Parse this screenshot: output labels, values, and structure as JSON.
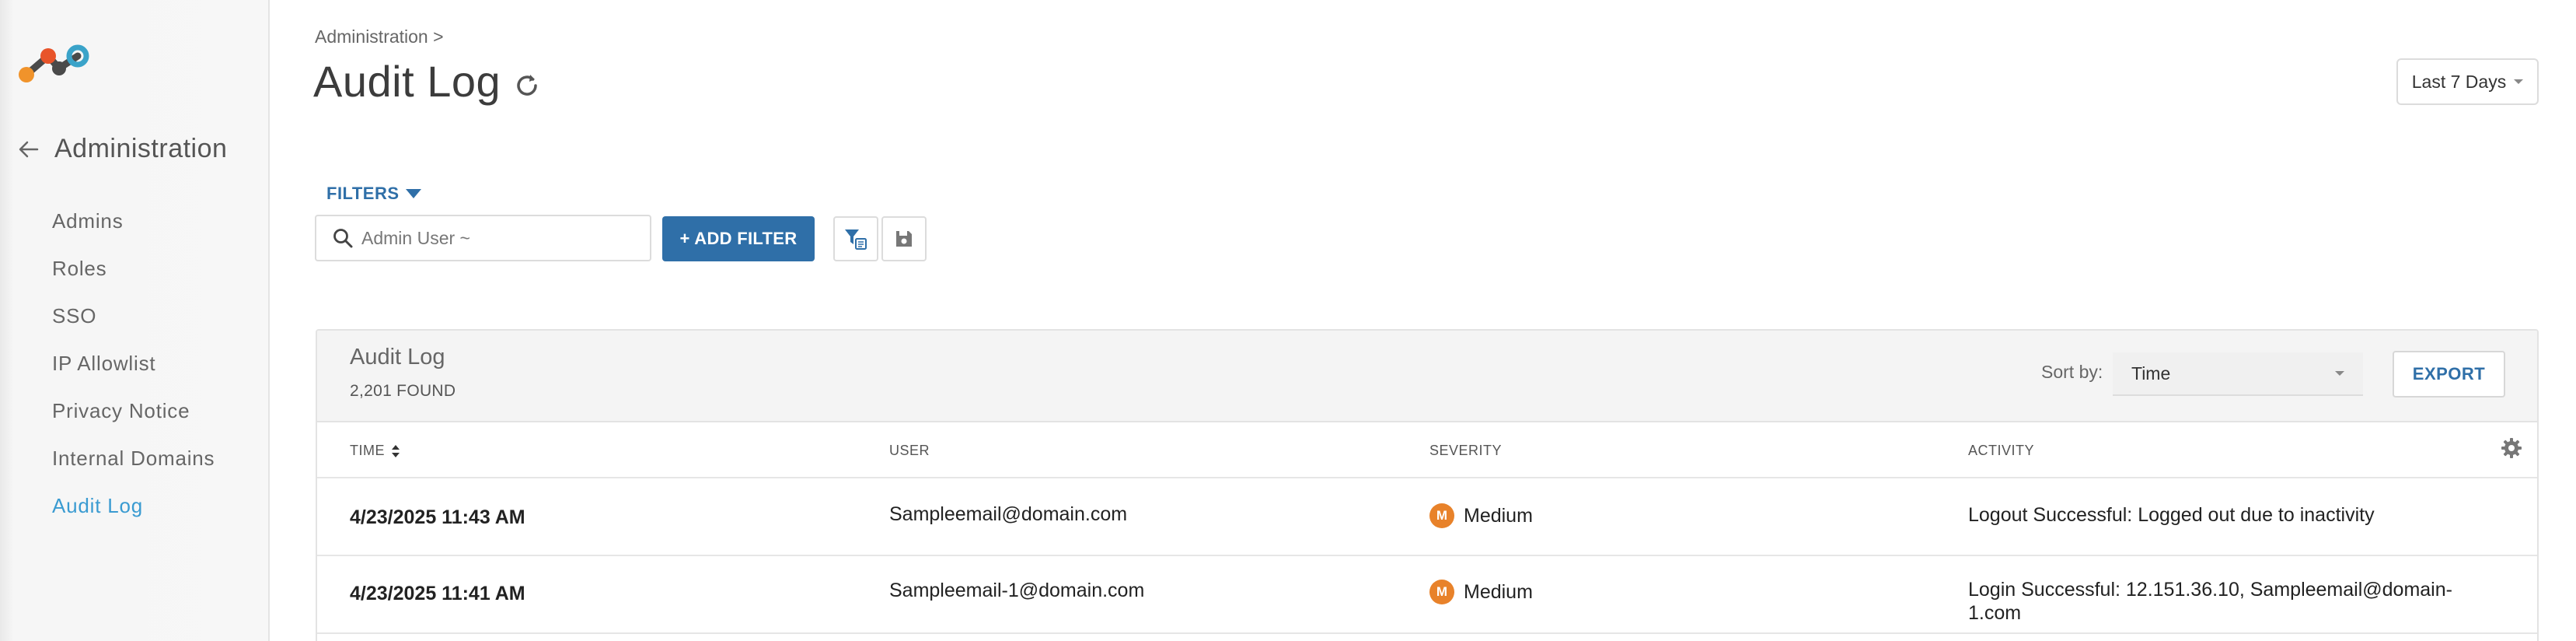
{
  "sidebar": {
    "section_title": "Administration",
    "items": [
      {
        "label": "Admins"
      },
      {
        "label": "Roles"
      },
      {
        "label": "SSO"
      },
      {
        "label": "IP Allowlist"
      },
      {
        "label": "Privacy Notice"
      },
      {
        "label": "Internal Domains"
      },
      {
        "label": "Audit Log",
        "active": true
      }
    ]
  },
  "header": {
    "breadcrumb": "Administration >",
    "title": "Audit Log",
    "date_range": "Last 7 Days"
  },
  "filters": {
    "toggle_label": "FILTERS",
    "search_placeholder": "Admin User ~",
    "add_filter_label": "+ ADD FILTER"
  },
  "panel": {
    "title": "Audit Log",
    "found": "2,201 FOUND",
    "sort_label": "Sort by:",
    "sort_value": "Time",
    "export_label": "EXPORT"
  },
  "table": {
    "columns": [
      "TIME",
      "USER",
      "SEVERITY",
      "ACTIVITY"
    ],
    "rows": [
      {
        "time": "4/23/2025 11:43 AM",
        "user": "Sampleemail@domain.com",
        "severity_badge": "M",
        "severity": "Medium",
        "activity": "Logout Successful: Logged out due to inactivity"
      },
      {
        "time": "4/23/2025 11:41 AM",
        "user": "Sampleemail-1@domain.com",
        "severity_badge": "M",
        "severity": "Medium",
        "activity": "Login Successful: 12.151.36.10, Sampleemail@domain-1.com"
      }
    ]
  },
  "colors": {
    "accent": "#2f6fa8",
    "active_nav": "#3a9bd1",
    "severity_medium": "#e8822a"
  }
}
